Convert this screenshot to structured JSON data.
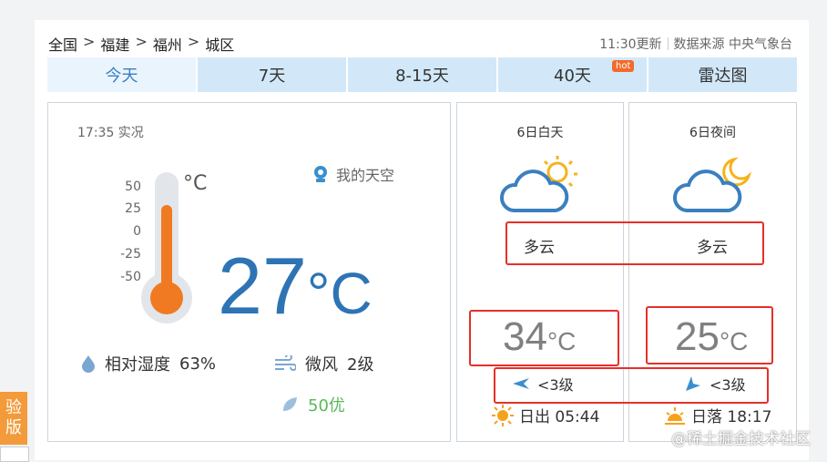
{
  "breadcrumb": [
    "全国",
    "福建",
    "福州",
    "城区"
  ],
  "breadcrumb_sep": ">",
  "meta": {
    "updated": "11:30更新",
    "source": "数据来源 中央气象台"
  },
  "tabs": [
    {
      "label": "今天",
      "active": true
    },
    {
      "label": "7天"
    },
    {
      "label": "8-15天"
    },
    {
      "label": "40天",
      "badge": "hot"
    },
    {
      "label": "雷达图"
    }
  ],
  "current": {
    "time_label": "17:35 实况",
    "my_sky": "我的天空",
    "scale": [
      "50",
      "25",
      "0",
      "-25",
      "-50"
    ],
    "scale_unit": "°C",
    "temp": "27",
    "temp_unit": "°C",
    "humidity_label": "相对湿度",
    "humidity_value": "63%",
    "wind_label": "微风",
    "wind_value": "2级",
    "aqi": "50优"
  },
  "day": {
    "title": "6日白天",
    "weather": "多云",
    "temp": "34",
    "unit": "°C",
    "wind": "<3级",
    "sun": "日出 05:44"
  },
  "night": {
    "title": "6日夜间",
    "weather": "多云",
    "temp": "25",
    "unit": "°C",
    "wind": "<3级",
    "sun": "日落 18:17"
  },
  "side_tab": [
    "验",
    "版"
  ],
  "watermark": "@稀土掘金技术社区",
  "colors": {
    "accent": "#2e74b5",
    "tab_bg": "#d2e8f9",
    "highlight": "#e53029",
    "aqi_good": "#5cb85c"
  }
}
